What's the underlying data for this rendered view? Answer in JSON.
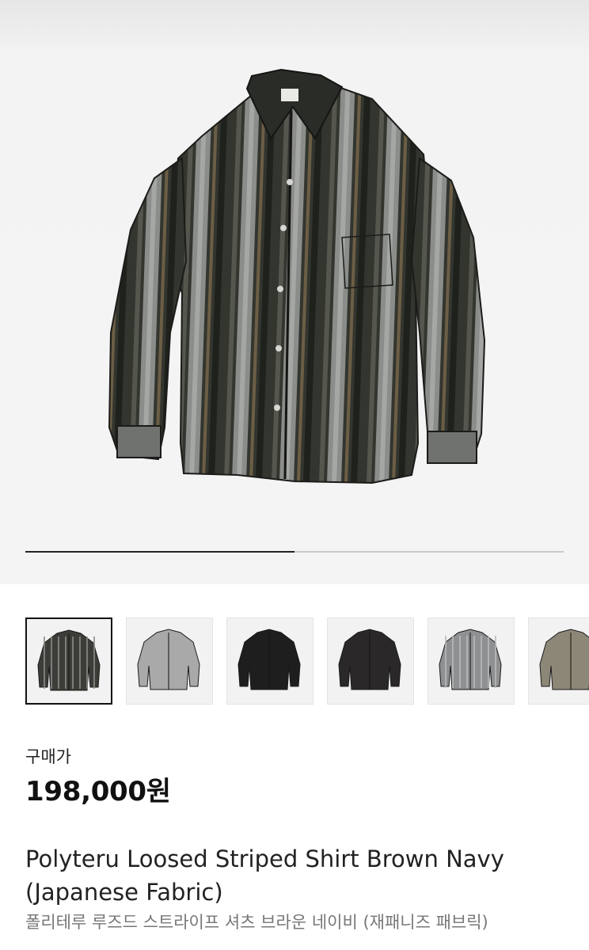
{
  "product": {
    "price_label": "구매가",
    "price": "198,000원",
    "title": "Polyteru Loosed Striped Shirt Brown Navy (Japanese Fabric)",
    "subtitle": "폴리테루 루즈드 스트라이프 셔츠 브라운 네이비 (재패니즈 패브릭)"
  },
  "gallery": {
    "progress_fraction": 0.5,
    "selected_index": 0,
    "thumbnails": [
      {
        "icon": "shirt-striped-brown-navy",
        "color": "#3c3d38",
        "stripe": "#8a8d88",
        "striped": true
      },
      {
        "icon": "shirt-light-grey",
        "color": "#a9a9a9",
        "stripe": "",
        "striped": false
      },
      {
        "icon": "shirt-black",
        "color": "#1e1e1e",
        "stripe": "",
        "striped": false
      },
      {
        "icon": "shirt-charcoal",
        "color": "#2a2829",
        "stripe": "",
        "striped": false
      },
      {
        "icon": "shirt-grey-stripe",
        "color": "#8e9092",
        "stripe": "#b9bbbd",
        "striped": true
      },
      {
        "icon": "shirt-khaki",
        "color": "#8d8778",
        "stripe": "",
        "striped": false
      }
    ]
  },
  "colors": {
    "main_shirt_dark": "#2f312c",
    "main_shirt_light": "#8d908c",
    "accent_text": "#111111",
    "muted_text": "#777777"
  }
}
